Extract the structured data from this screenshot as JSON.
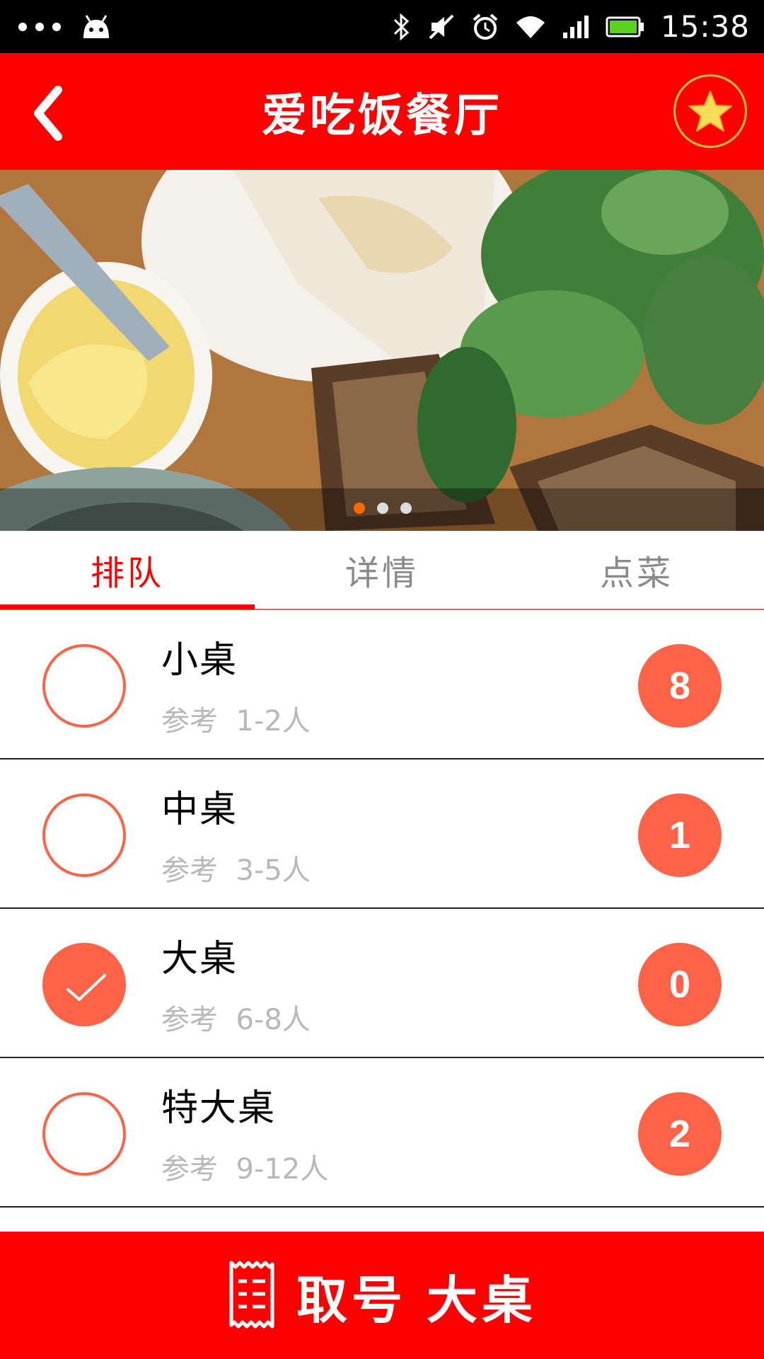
{
  "status_bar": {
    "time": "15:38",
    "icons": [
      "more-dots-icon",
      "android-icon",
      "bluetooth-icon",
      "mute-icon",
      "alarm-icon",
      "wifi-icon",
      "signal-icon",
      "battery-icon"
    ]
  },
  "header": {
    "title": "爱吃饭餐厅",
    "back_icon": "chevron-left-icon",
    "favorite_icon": "star-icon"
  },
  "banner": {
    "page_count": 3,
    "active_page": 1
  },
  "tabs": [
    {
      "label": "排队",
      "active": true
    },
    {
      "label": "详情",
      "active": false
    },
    {
      "label": "点菜",
      "active": false
    }
  ],
  "tables": [
    {
      "name": "小桌",
      "ref_label": "参考",
      "ref_range": "1-2人",
      "count": "8",
      "selected": false
    },
    {
      "name": "中桌",
      "ref_label": "参考",
      "ref_range": "3-5人",
      "count": "1",
      "selected": false
    },
    {
      "name": "大桌",
      "ref_label": "参考",
      "ref_range": "6-8人",
      "count": "0",
      "selected": true
    },
    {
      "name": "特大桌",
      "ref_label": "参考",
      "ref_range": "9-12人",
      "count": "2",
      "selected": false
    }
  ],
  "action": {
    "label": "取号",
    "selected_table": "大桌",
    "icon": "ticket-icon"
  },
  "colors": {
    "primary": "#fe0000",
    "accent": "#ff6347",
    "star": "#f5c13a",
    "pager_active": "#ff6a00"
  }
}
